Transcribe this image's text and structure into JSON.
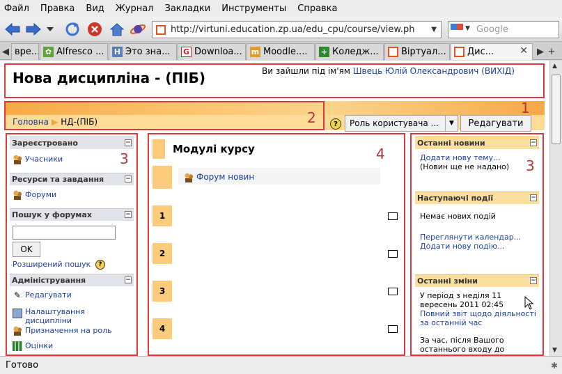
{
  "menu": [
    "Файл",
    "Правка",
    "Вид",
    "Журнал",
    "Закладки",
    "Инструменты",
    "Справка"
  ],
  "url": "http://virtuni.education.zp.ua/edu_cpu/course/view.ph",
  "search_placeholder": "Google",
  "tabs": [
    {
      "label": "вре..."
    },
    {
      "label": "Alfresco ..."
    },
    {
      "label": "Это зна..."
    },
    {
      "label": "Downloa..."
    },
    {
      "label": "Moodle...."
    },
    {
      "label": "Коледж..."
    },
    {
      "label": "Віртуал..."
    },
    {
      "label": "Дис..."
    }
  ],
  "status": "Готово",
  "header": {
    "title": "Нова дисципліна - (ПІБ)",
    "login_prefix": "Ви зайшли під ім'ям",
    "user": "Швець Юлій Олександрович",
    "logout": "(ВИХІД)"
  },
  "breadcrumb": {
    "home": "Головна",
    "sep": "▶",
    "current": "НД-(ПІБ)"
  },
  "role_select": "Роль користувача ...",
  "edit_button": "Редагувати",
  "annotations": {
    "n1": "1",
    "n2": "2",
    "n3_left": "3",
    "n3_right": "3",
    "n4": "4"
  },
  "left": {
    "registered": {
      "title": "Зареєстровано",
      "participants": "Учасники"
    },
    "resources": {
      "title": "Ресурси та завдання",
      "forums": "Форуми"
    },
    "forum_search": {
      "title": "Пошук у форумах",
      "button": "OK",
      "advanced": "Розширений пошук"
    },
    "admin": {
      "title": "Адміністрування",
      "items": [
        "Редагувати",
        "Налаштування дисципліни",
        "Призначення на роль",
        "Оцінки"
      ]
    }
  },
  "center": {
    "title": "Модулі курсу",
    "news_forum": "Форум новин",
    "sections": [
      "1",
      "2",
      "3",
      "4"
    ]
  },
  "right": {
    "news": {
      "title": "Останні новини",
      "add": "Додати нову тему...",
      "none": "(Новин ще не надано)"
    },
    "events": {
      "title": "Наступаючі події",
      "none": "Немає нових подій",
      "calendar": "Переглянути календар...",
      "add": "Додати нову подію..."
    },
    "changes": {
      "title": "Останні зміни",
      "period": "У період з неділя 11 вересень 2011 02:45",
      "full_report": "Повний звіт щодо діяльності за останній час",
      "since": "За час, після Вашого останнього входу до"
    }
  }
}
